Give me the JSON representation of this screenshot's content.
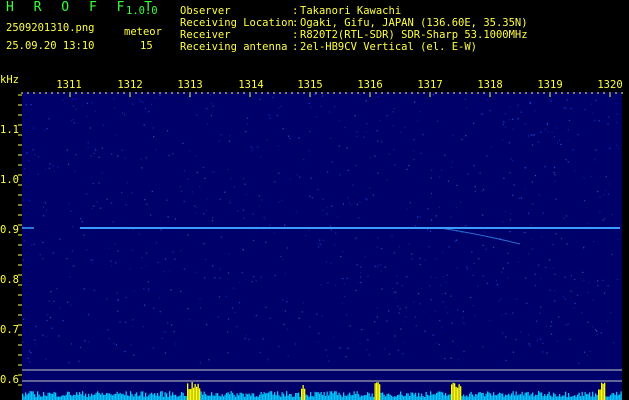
{
  "app": {
    "title": "H R O F F T",
    "version": "1.0.0",
    "filename": "2509201310.png",
    "datetime": "25.09.20 13:10",
    "meteor_label": "meteor",
    "meteor_count": "15"
  },
  "station": {
    "rows": [
      {
        "label": "Observer",
        "value": "Takanori Kawachi"
      },
      {
        "label": "Receiving Location",
        "value": "Ogaki, Gifu, JAPAN (136.60E, 35.35N)"
      },
      {
        "label": "Receiver",
        "value": "R820T2(RTL-SDR) SDR-Sharp 53.1000MHz"
      },
      {
        "label": "Receiving antenna",
        "value": "2el-HB9CV Vertical (el. E-W)"
      }
    ],
    "separator": ":"
  },
  "spectrogram": {
    "unit": "kHz",
    "x_ticks": [
      "1311",
      "1312",
      "1313",
      "1314",
      "1315",
      "1316",
      "1317",
      "1318",
      "1319",
      "1320"
    ],
    "y_ticks": [
      "1.1",
      "1.0",
      "0.9",
      "0.8",
      "0.7",
      "0.6"
    ],
    "colors": {
      "background": "#000000",
      "plot_bg": "#00006a",
      "label": "#ffff40",
      "trace": "#3a9cff",
      "bars": "#00c8ff",
      "bar_peak": "#ffff00"
    }
  }
}
